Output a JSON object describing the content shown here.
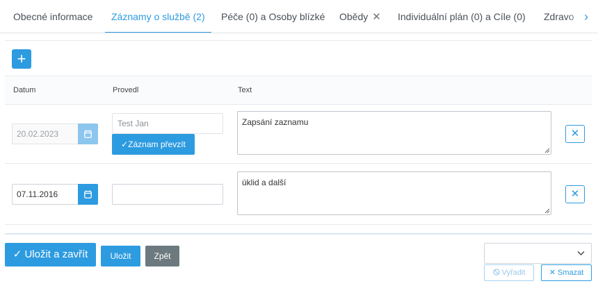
{
  "tabs": [
    {
      "label": "Obecné informace"
    },
    {
      "label": "Záznamy o službě (2)"
    },
    {
      "label": "Péče (0) a Osoby blízké"
    },
    {
      "label": "Obědy",
      "close": "✕"
    },
    {
      "label": "Individuální plán (0) a Cíle (0)"
    },
    {
      "label": "Zdravo"
    }
  ],
  "tab_next_icon": "›",
  "add_button": "+",
  "columns": {
    "datum": "Datum",
    "provedl": "Provedl",
    "text": "Text"
  },
  "records": [
    {
      "date": "20.02.2023",
      "provedl": "Test Jan",
      "text": "Zapsání zaznamu",
      "take_over": "Záznam převzít",
      "delete": "✕"
    },
    {
      "date": "07.11.2016",
      "provedl": "",
      "text": "úklid a další",
      "delete": "✕"
    }
  ],
  "footer": {
    "save_close": "Uložit a zavřít",
    "save_close_icon": "✓",
    "save": "Uložit",
    "back": "Zpět",
    "select_value": "",
    "discard": "Vyřadit",
    "delete": "Smazat",
    "delete_icon": "✕"
  },
  "colors": {
    "accent": "#2d9be0",
    "secondary": "#6c7a7f"
  }
}
